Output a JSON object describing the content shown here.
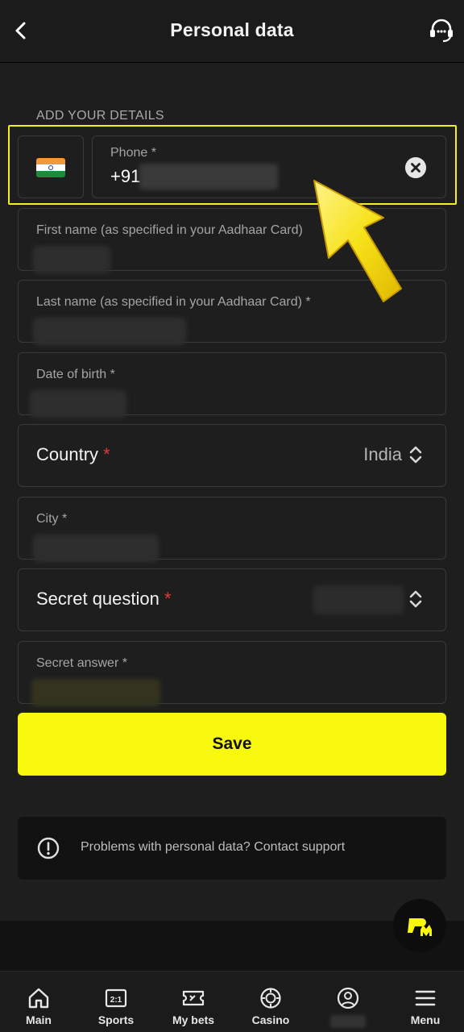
{
  "header": {
    "title": "Personal data"
  },
  "form": {
    "section_label": "ADD YOUR DETAILS",
    "phone": {
      "label": "Phone *",
      "prefix": "+91",
      "country_flag": "India"
    },
    "first_name": {
      "label": "First name (as specified in your Aadhaar Card)"
    },
    "last_name": {
      "label": "Last name (as specified in your Aadhaar Card) *"
    },
    "dob": {
      "label": "Date of birth *"
    },
    "country": {
      "label": "Country",
      "required_mark": "*",
      "value": "India"
    },
    "city": {
      "label": "City *"
    },
    "secret_question": {
      "label": "Secret question",
      "required_mark": "*"
    },
    "secret_answer": {
      "label": "Secret answer *"
    },
    "save_label": "Save"
  },
  "notice": {
    "text": "Problems with personal data? Contact support"
  },
  "nav": [
    {
      "label": "Main",
      "icon": "home-icon"
    },
    {
      "label": "Sports",
      "icon": "scoreboard-icon"
    },
    {
      "label": "My bets",
      "icon": "ticket-icon"
    },
    {
      "label": "Casino",
      "icon": "chip-icon"
    },
    {
      "label": "",
      "icon": "profile-icon"
    },
    {
      "label": "Menu",
      "icon": "menu-icon"
    }
  ],
  "colors": {
    "accent": "#f8f80e",
    "required": "#e53935",
    "background": "#1e1e1e"
  }
}
